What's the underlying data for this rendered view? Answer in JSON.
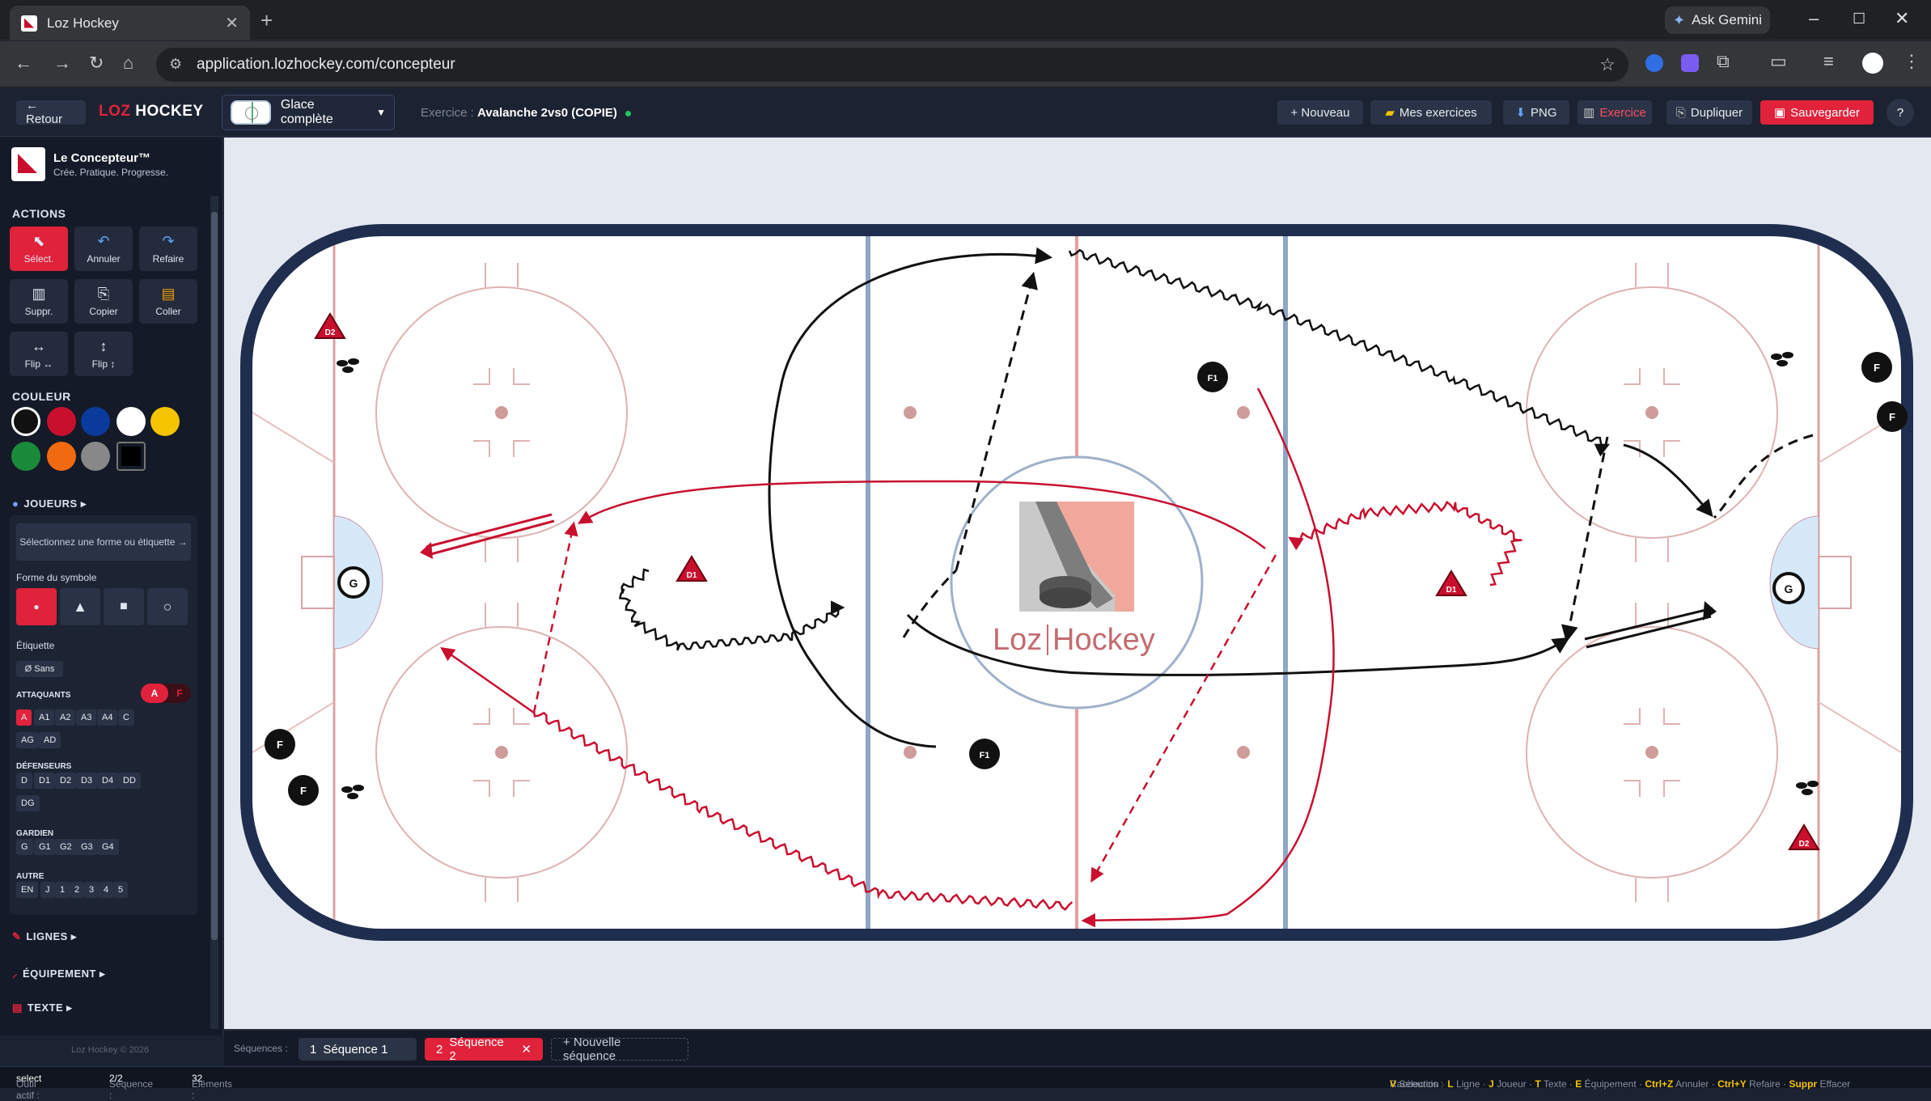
{
  "browser": {
    "tab_title": "Loz Hockey",
    "tab_close": "✕",
    "new_tab": "+",
    "gemini": "Ask Gemini",
    "url": "application.lozhockey.com/concepteur"
  },
  "header": {
    "back": "← Retour",
    "logo_loz": "LOZ",
    "logo_hockey": "HOCKEY",
    "surface": "Glace complète",
    "exercise_label": "Exercice :",
    "exercise_name": "Avalanche 2vs0 (COPIE)",
    "buttons": {
      "new": "+ Nouveau",
      "mine": "Mes exercices",
      "png": "PNG",
      "exercise": "Exercice",
      "duplicate": "Dupliquer",
      "save": "Sauvegarder",
      "help": "?"
    }
  },
  "sidebar": {
    "brand_title": "Le Concepteur™",
    "brand_tagline": "Crée. Pratique. Progresse.",
    "actions_title": "ACTIONS",
    "actions": {
      "select": "Sélect.",
      "undo": "Annuler",
      "redo": "Refaire",
      "delete": "Suppr.",
      "copy": "Copier",
      "paste": "Coller",
      "flip_h": "Flip ↔",
      "flip_v": "Flip ↕"
    },
    "color_title": "COULEUR",
    "colors": [
      "#111111",
      "#c8102e",
      "#0a3a9b",
      "#ffffff",
      "#f5c400",
      "#1a8a3a",
      "#f26a10",
      "#888888",
      "#000000"
    ],
    "players_title": "JOUEURS ▸",
    "hint": "Sélectionnez une forme ou étiquette →",
    "shape_label": "Forme du symbole",
    "label_label": "Étiquette",
    "label_none": "Ø Sans",
    "toggle_a": "A",
    "toggle_f": "F",
    "attackers_title": "ATTAQUANTS",
    "attackers": [
      "A",
      "A1",
      "A2",
      "A3",
      "A4",
      "C",
      "AG",
      "AD"
    ],
    "defense_title": "DÉFENSEURS",
    "defense": [
      "D",
      "D1",
      "D2",
      "D3",
      "D4",
      "DD",
      "DG"
    ],
    "goalie_title": "GARDIEN",
    "goalie": [
      "G",
      "G1",
      "G2",
      "G3",
      "G4"
    ],
    "other_title": "AUTRE",
    "other": [
      "EN",
      "J",
      "1",
      "2",
      "3",
      "4",
      "5"
    ],
    "lines_title": "LIGNES ▸",
    "equipment_title": "ÉQUIPEMENT ▸",
    "text_title": "TEXTE ▸",
    "footer": "Loz Hockey © 2026"
  },
  "rink": {
    "logo_loz": "Loz",
    "logo_hockey": "Hockey",
    "players": {
      "F1_top": "F1",
      "F1_bottom": "F1",
      "D1_left": "D1",
      "D1_right": "D1",
      "D2_left": "D2",
      "D2_right": "D2",
      "G_left": "G",
      "G_right": "G",
      "F_left_1": "F",
      "F_left_2": "F",
      "F_right_1": "F",
      "F_right_2": "F"
    }
  },
  "sequences": {
    "label": "Séquences :",
    "items": [
      {
        "num": "1",
        "name": "Séquence 1"
      },
      {
        "num": "2",
        "name": "Séquence 2",
        "close": "✕"
      }
    ],
    "new": "+ Nouvelle séquence"
  },
  "status": {
    "tool_label": "Outil actif :",
    "tool": "select",
    "seq_label": "Séquence :",
    "seq": "2/2",
    "elements_label": "Éléments :",
    "elements": "32",
    "shortcuts_label": "Raccourcis :",
    "shortcuts": [
      {
        "key": "V",
        "text": "Sélection"
      },
      {
        "key": "L",
        "text": "Ligne"
      },
      {
        "key": "J",
        "text": "Joueur"
      },
      {
        "key": "T",
        "text": "Texte"
      },
      {
        "key": "E",
        "text": "Équipement"
      },
      {
        "key": "Ctrl+Z",
        "text": "Annuler"
      },
      {
        "key": "Ctrl+Y",
        "text": "Refaire"
      },
      {
        "key": "Suppr",
        "text": "Effacer"
      }
    ]
  }
}
